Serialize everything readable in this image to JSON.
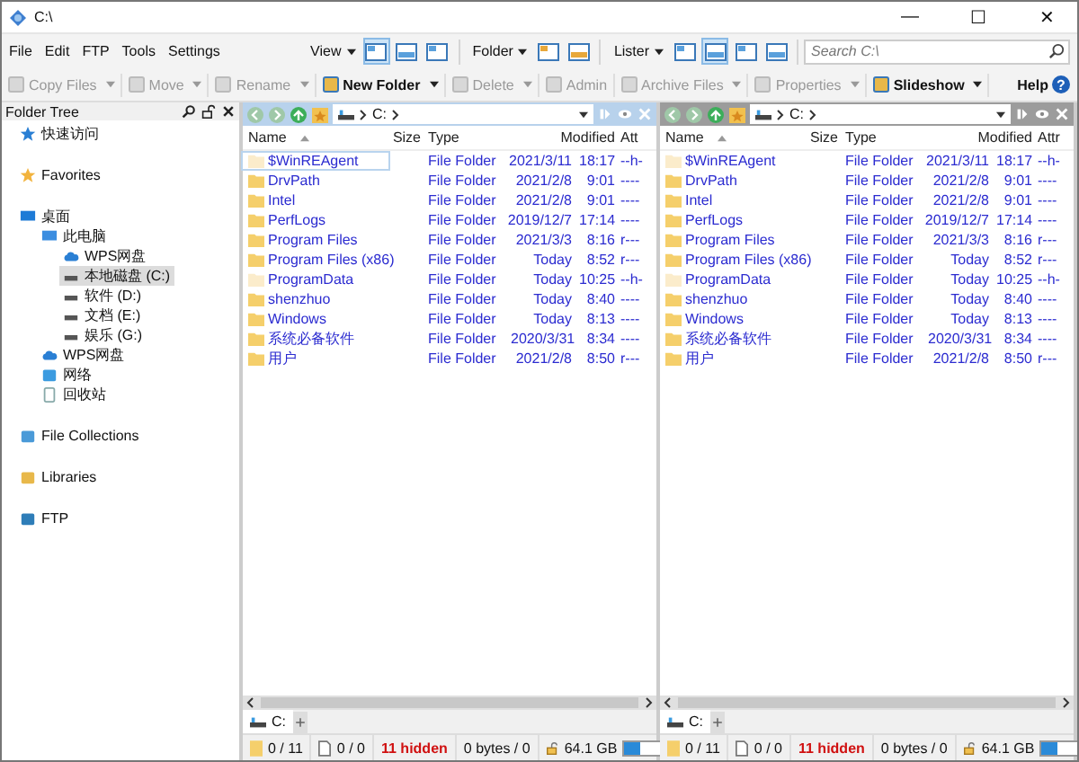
{
  "window": {
    "title": "C:\\",
    "controls": [
      "—",
      "☐",
      "✕"
    ]
  },
  "menu": [
    "File",
    "Edit",
    "FTP",
    "Tools",
    "Settings"
  ],
  "view_groups": [
    {
      "label": "View",
      "buttons": [
        {
          "selected": true
        },
        {
          "selected": false
        },
        {
          "selected": false
        }
      ]
    },
    {
      "label": "Folder",
      "buttons": [
        {
          "selected": false
        },
        {
          "selected": false
        }
      ]
    },
    {
      "label": "Lister",
      "buttons": [
        {
          "selected": false
        },
        {
          "selected": true
        },
        {
          "selected": false
        },
        {
          "selected": false
        }
      ]
    }
  ],
  "search": {
    "placeholder": "Search C:\\"
  },
  "toolbar": [
    {
      "label": "Copy Files",
      "disabled": true,
      "dropdown": true
    },
    {
      "label": "Move",
      "disabled": true,
      "dropdown": true
    },
    {
      "label": "Rename",
      "disabled": true,
      "dropdown": true
    },
    {
      "label": "New Folder",
      "disabled": false,
      "dropdown": true
    },
    {
      "label": "Delete",
      "disabled": true,
      "dropdown": true
    },
    {
      "label": "Admin",
      "disabled": true,
      "dropdown": false
    },
    {
      "label": "Archive Files",
      "disabled": true,
      "dropdown": true
    },
    {
      "label": "Properties",
      "disabled": true,
      "dropdown": true
    },
    {
      "label": "Slideshow",
      "disabled": false,
      "dropdown": true
    }
  ],
  "help": {
    "label": "Help",
    "icon": "?"
  },
  "folder_tree": {
    "title": "Folder Tree",
    "groups": [
      [
        {
          "label": "快速访问",
          "kind": "star",
          "selected": false
        }
      ],
      [
        {
          "label": "Favorites",
          "kind": "favorites",
          "selected": false
        }
      ],
      [
        {
          "label": "桌面",
          "kind": "desktop",
          "selected": false,
          "children": [
            {
              "label": "此电脑",
              "kind": "pc",
              "selected": false,
              "children": [
                {
                  "label": "WPS网盘",
                  "kind": "cloud",
                  "selected": false
                },
                {
                  "label": "本地磁盘 (C:)",
                  "kind": "drive",
                  "selected": true
                },
                {
                  "label": "软件 (D:)",
                  "kind": "drive",
                  "selected": false
                },
                {
                  "label": "文档 (E:)",
                  "kind": "drive",
                  "selected": false
                },
                {
                  "label": "娱乐 (G:)",
                  "kind": "drive",
                  "selected": false
                }
              ]
            },
            {
              "label": "WPS网盘",
              "kind": "cloud",
              "selected": false
            },
            {
              "label": "网络",
              "kind": "network",
              "selected": false
            },
            {
              "label": "回收站",
              "kind": "bin",
              "selected": false
            }
          ]
        }
      ],
      [
        {
          "label": "File Collections",
          "kind": "collections",
          "selected": false
        }
      ],
      [
        {
          "label": "Libraries",
          "kind": "libraries",
          "selected": false
        }
      ],
      [
        {
          "label": "FTP",
          "kind": "ftp",
          "selected": false
        }
      ]
    ]
  },
  "listers": [
    {
      "active": true,
      "path": [
        "C:"
      ],
      "columns": [
        "Name",
        "Size",
        "Type",
        "Modified",
        "Att"
      ],
      "rows": [
        {
          "name": "$WinREAgent",
          "type": "File Folder",
          "date": "2021/3/11",
          "time": "18:17",
          "attr": "--h-",
          "hidden": true,
          "focused": true
        },
        {
          "name": "DrvPath",
          "type": "File Folder",
          "date": "2021/2/8",
          "time": "9:01",
          "attr": "----",
          "hidden": false,
          "focused": false
        },
        {
          "name": "Intel",
          "type": "File Folder",
          "date": "2021/2/8",
          "time": "9:01",
          "attr": "----",
          "hidden": false,
          "focused": false
        },
        {
          "name": "PerfLogs",
          "type": "File Folder",
          "date": "2019/12/7",
          "time": "17:14",
          "attr": "----",
          "hidden": false,
          "focused": false
        },
        {
          "name": "Program Files",
          "type": "File Folder",
          "date": "2021/3/3",
          "time": "8:16",
          "attr": "r---",
          "hidden": false,
          "focused": false
        },
        {
          "name": "Program Files (x86)",
          "type": "File Folder",
          "date": "Today",
          "time": "8:52",
          "attr": "r---",
          "hidden": false,
          "focused": false
        },
        {
          "name": "ProgramData",
          "type": "File Folder",
          "date": "Today",
          "time": "10:25",
          "attr": "--h-",
          "hidden": true,
          "focused": false
        },
        {
          "name": "shenzhuo",
          "type": "File Folder",
          "date": "Today",
          "time": "8:40",
          "attr": "----",
          "hidden": false,
          "focused": false
        },
        {
          "name": "Windows",
          "type": "File Folder",
          "date": "Today",
          "time": "8:13",
          "attr": "----",
          "hidden": false,
          "focused": false
        },
        {
          "name": "系统必备软件",
          "type": "File Folder",
          "date": "2020/3/31",
          "time": "8:34",
          "attr": "----",
          "hidden": false,
          "focused": false
        },
        {
          "name": "用户",
          "type": "File Folder",
          "date": "2021/2/8",
          "time": "8:50",
          "attr": "r---",
          "hidden": false,
          "focused": false
        }
      ],
      "tabs": [
        {
          "label": "C:",
          "selected": true
        }
      ],
      "status": {
        "folders": "0 / 11",
        "files": "0 / 0",
        "hidden": "11 hidden",
        "bytes": "0 bytes / 0",
        "free": "64.1 GB",
        "level": 0.35
      }
    },
    {
      "active": false,
      "path": [
        "C:"
      ],
      "columns": [
        "Name",
        "Size",
        "Type",
        "Modified",
        "Attr"
      ],
      "rows": [
        {
          "name": "$WinREAgent",
          "type": "File Folder",
          "date": "2021/3/11",
          "time": "18:17",
          "attr": "--h-",
          "hidden": true,
          "focused": false
        },
        {
          "name": "DrvPath",
          "type": "File Folder",
          "date": "2021/2/8",
          "time": "9:01",
          "attr": "----",
          "hidden": false,
          "focused": false
        },
        {
          "name": "Intel",
          "type": "File Folder",
          "date": "2021/2/8",
          "time": "9:01",
          "attr": "----",
          "hidden": false,
          "focused": false
        },
        {
          "name": "PerfLogs",
          "type": "File Folder",
          "date": "2019/12/7",
          "time": "17:14",
          "attr": "----",
          "hidden": false,
          "focused": false
        },
        {
          "name": "Program Files",
          "type": "File Folder",
          "date": "2021/3/3",
          "time": "8:16",
          "attr": "r---",
          "hidden": false,
          "focused": false
        },
        {
          "name": "Program Files (x86)",
          "type": "File Folder",
          "date": "Today",
          "time": "8:52",
          "attr": "r---",
          "hidden": false,
          "focused": false
        },
        {
          "name": "ProgramData",
          "type": "File Folder",
          "date": "Today",
          "time": "10:25",
          "attr": "--h-",
          "hidden": true,
          "focused": false
        },
        {
          "name": "shenzhuo",
          "type": "File Folder",
          "date": "Today",
          "time": "8:40",
          "attr": "----",
          "hidden": false,
          "focused": false
        },
        {
          "name": "Windows",
          "type": "File Folder",
          "date": "Today",
          "time": "8:13",
          "attr": "----",
          "hidden": false,
          "focused": false
        },
        {
          "name": "系统必备软件",
          "type": "File Folder",
          "date": "2020/3/31",
          "time": "8:34",
          "attr": "----",
          "hidden": false,
          "focused": false
        },
        {
          "name": "用户",
          "type": "File Folder",
          "date": "2021/2/8",
          "time": "8:50",
          "attr": "r---",
          "hidden": false,
          "focused": false
        }
      ],
      "tabs": [
        {
          "label": "C:",
          "selected": true
        }
      ],
      "status": {
        "folders": "0 / 11",
        "files": "0 / 0",
        "hidden": "11 hidden",
        "bytes": "0 bytes / 0",
        "free": "64.1 GB",
        "level": 0.35
      }
    }
  ]
}
